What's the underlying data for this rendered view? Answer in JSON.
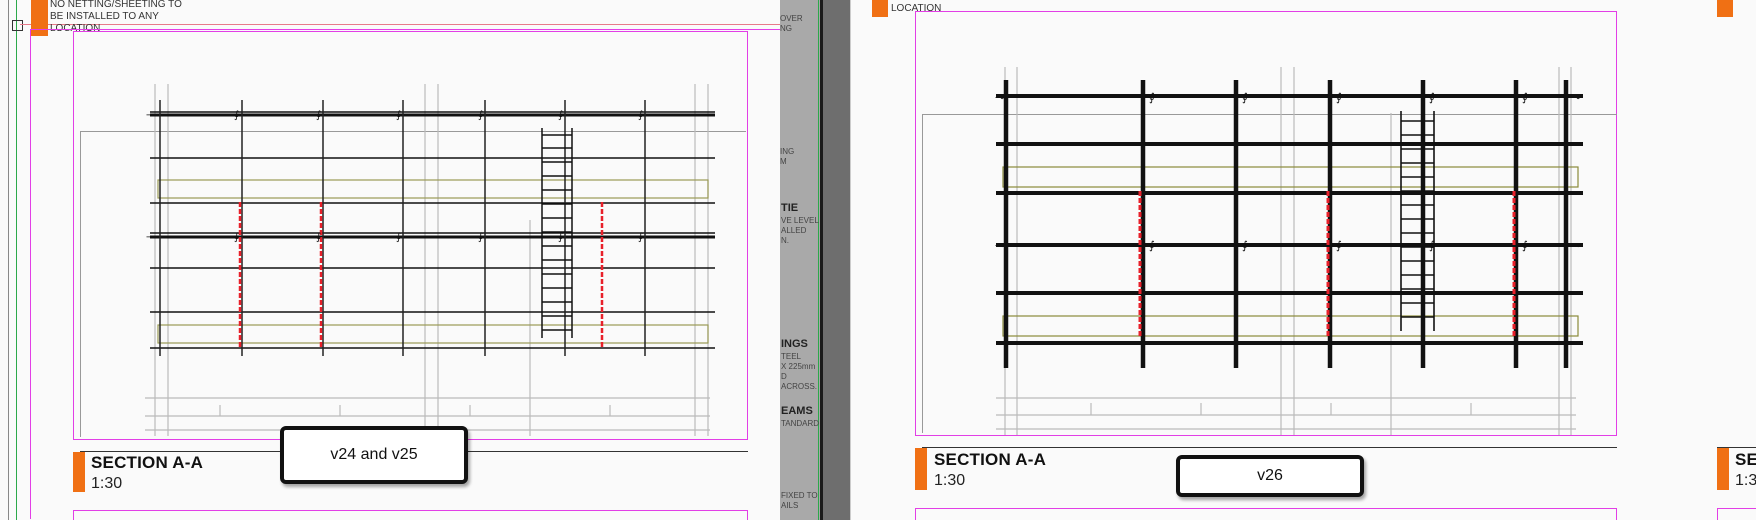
{
  "left_panel": {
    "note": "NO NETTING/SHEETING TO\nBE INSTALLED TO ANY\nLOCATION",
    "section_title": "SECTION A-A",
    "scale": "1:30",
    "version_label": "v24 and v25"
  },
  "middle_strip": {
    "top_text": "OVER\nNG",
    "text_2": "ING\nM",
    "tie_heading": "TIE",
    "tie_text": "VE LEVEL\nALLED\nN.",
    "ings_heading": "INGS",
    "ings_text": "TEEL\nX 225mm\nD ACROSS.",
    "eams_heading": "EAMS",
    "eams_text": "TANDARD",
    "bottom_text": "FIXED TO\nAILS"
  },
  "right_panel": {
    "note": "LOCATION",
    "section_title": "SECTION A-A",
    "scale": "1:30",
    "version_label": "v26"
  },
  "far_right": {
    "section_title": "SE",
    "scale": "1:3"
  },
  "colors": {
    "accent_orange": "#f07014",
    "viewport_magenta": "#e23ee6",
    "tie_red": "#e8202a",
    "board_olive": "#8a8a3a"
  }
}
